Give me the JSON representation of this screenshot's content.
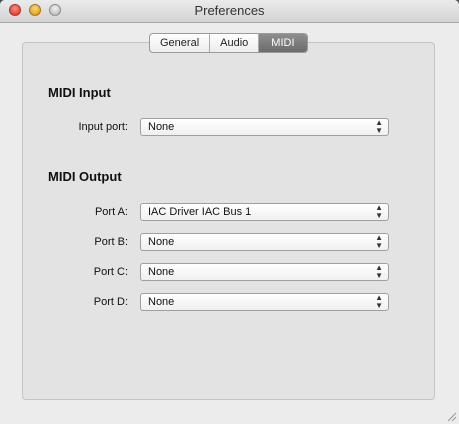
{
  "window": {
    "title": "Preferences",
    "controls": [
      "close-icon",
      "minimize-icon",
      "zoom-icon"
    ]
  },
  "tabs": [
    {
      "label": "General",
      "selected": false
    },
    {
      "label": "Audio",
      "selected": false
    },
    {
      "label": "MIDI",
      "selected": true
    }
  ],
  "midi_input": {
    "title": "MIDI Input",
    "rows": [
      {
        "label": "Input port:",
        "value": "None"
      }
    ]
  },
  "midi_output": {
    "title": "MIDI Output",
    "rows": [
      {
        "label": "Port A:",
        "value": "IAC Driver IAC Bus 1"
      },
      {
        "label": "Port B:",
        "value": "None"
      },
      {
        "label": "Port C:",
        "value": "None"
      },
      {
        "label": "Port D:",
        "value": "None"
      }
    ]
  },
  "colors": {
    "selected_tab": "#7a7a7a",
    "window_bg": "#ececec"
  }
}
